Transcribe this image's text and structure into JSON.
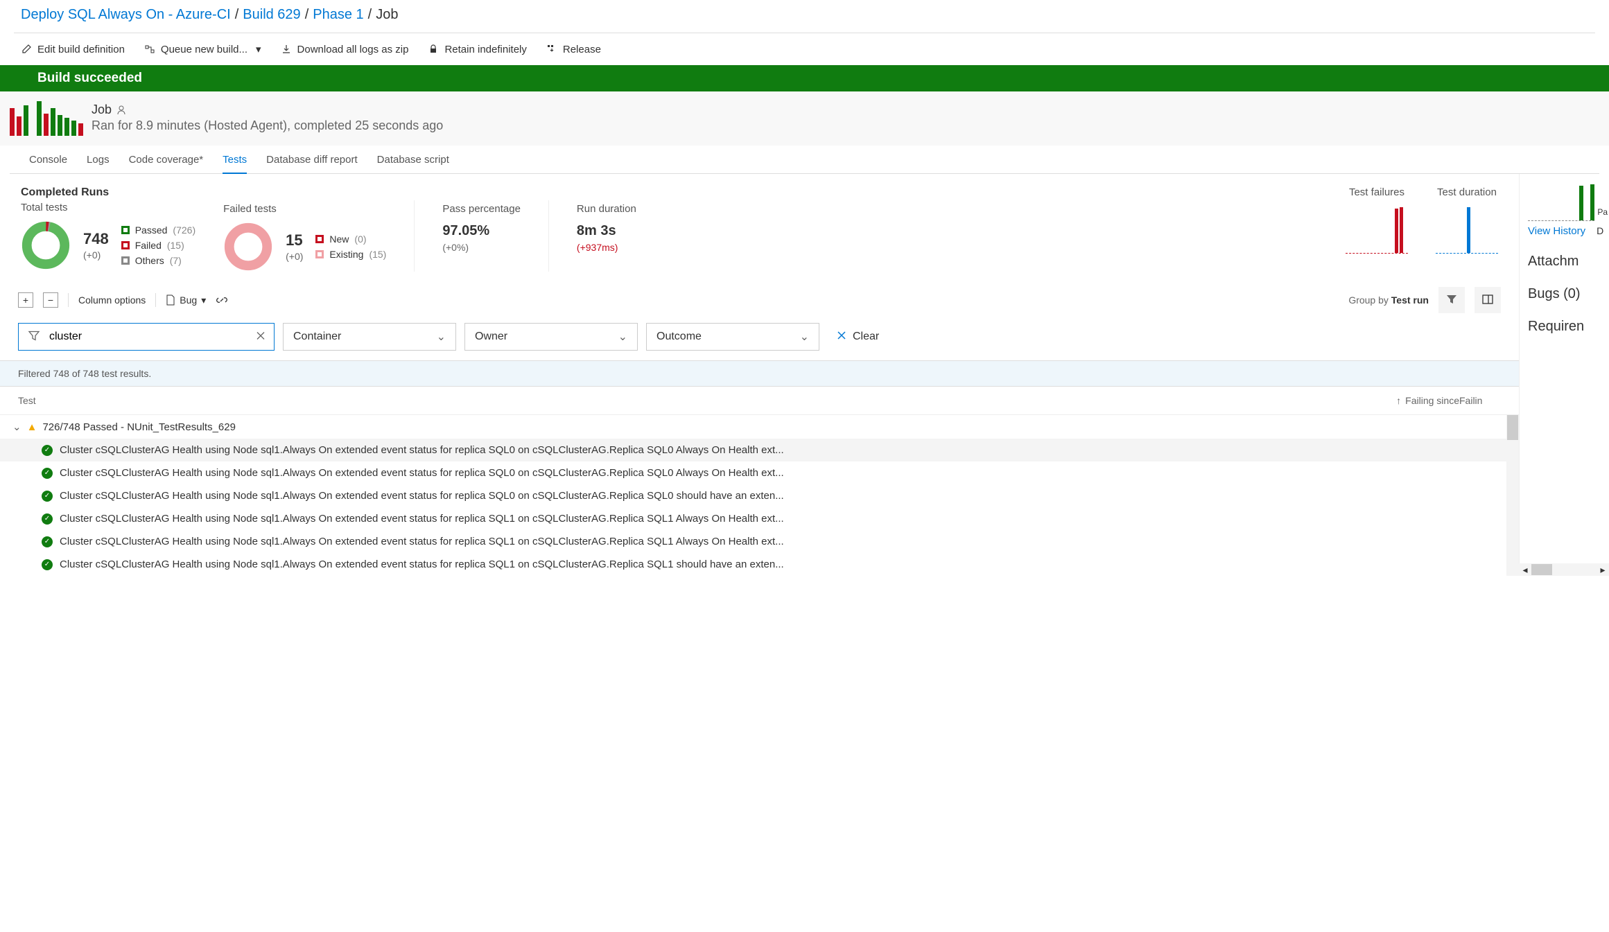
{
  "breadcrumb": {
    "project": "Deploy SQL Always On - Azure-CI",
    "build": "Build 629",
    "phase": "Phase 1",
    "current": "Job"
  },
  "toolbar": {
    "edit": "Edit build definition",
    "queue": "Queue new build...",
    "download": "Download all logs as zip",
    "retain": "Retain indefinitely",
    "release": "Release"
  },
  "status_banner": "Build succeeded",
  "job": {
    "title": "Job",
    "subtitle": "Ran for 8.9 minutes (Hosted Agent), completed 25 seconds ago"
  },
  "tabs": {
    "console": "Console",
    "logs": "Logs",
    "coverage": "Code coverage*",
    "tests": "Tests",
    "diff": "Database diff report",
    "script": "Database script"
  },
  "summary": {
    "completed_runs": "Completed Runs",
    "total_tests_label": "Total tests",
    "total_tests_value": "748",
    "total_tests_delta": "(+0)",
    "passed_label": "Passed",
    "passed_count": "(726)",
    "failed_label": "Failed",
    "failed_count": "(15)",
    "others_label": "Others",
    "others_count": "(7)",
    "failed_tests_label": "Failed tests",
    "failed_tests_value": "15",
    "failed_tests_delta": "(+0)",
    "new_label": "New",
    "new_count": "(0)",
    "existing_label": "Existing",
    "existing_count": "(15)",
    "pass_pct_label": "Pass percentage",
    "pass_pct_value": "97.05%",
    "pass_pct_delta": "(+0%)",
    "run_dur_label": "Run duration",
    "run_dur_value": "8m 3s",
    "run_dur_delta": "(+937ms)",
    "test_failures_label": "Test failures",
    "test_duration_label": "Test duration"
  },
  "toolbar2": {
    "column_options": "Column options",
    "bug": "Bug",
    "group_by_label": "Group by",
    "group_by_value": "Test run"
  },
  "filters": {
    "search_value": "cluster",
    "container": "Container",
    "owner": "Owner",
    "outcome": "Outcome",
    "clear": "Clear",
    "status": "Filtered 748 of 748 test results."
  },
  "results": {
    "col_test": "Test",
    "col_since": "Failing since",
    "col_build": "Failin",
    "group_label": "726/748 Passed - NUnit_TestResults_629",
    "rows": [
      "Cluster cSQLClusterAG Health using Node sql1.Always On extended event status for replica SQL0 on cSQLClusterAG.Replica SQL0 Always On Health ext...",
      "Cluster cSQLClusterAG Health using Node sql1.Always On extended event status for replica SQL0 on cSQLClusterAG.Replica SQL0 Always On Health ext...",
      "Cluster cSQLClusterAG Health using Node sql1.Always On extended event status for replica SQL0 on cSQLClusterAG.Replica SQL0 should have an exten...",
      "Cluster cSQLClusterAG Health using Node sql1.Always On extended event status for replica SQL1 on cSQLClusterAG.Replica SQL1 Always On Health ext...",
      "Cluster cSQLClusterAG Health using Node sql1.Always On extended event status for replica SQL1 on cSQLClusterAG.Replica SQL1 Always On Health ext...",
      "Cluster cSQLClusterAG Health using Node sql1.Always On extended event status for replica SQL1 on cSQLClusterAG.Replica SQL1 should have an exten..."
    ]
  },
  "side": {
    "view_history": "View History",
    "d": "D",
    "pa": "Pa",
    "attachments": "Attachm",
    "bugs": "Bugs (0)",
    "requirements": "Requiren"
  }
}
